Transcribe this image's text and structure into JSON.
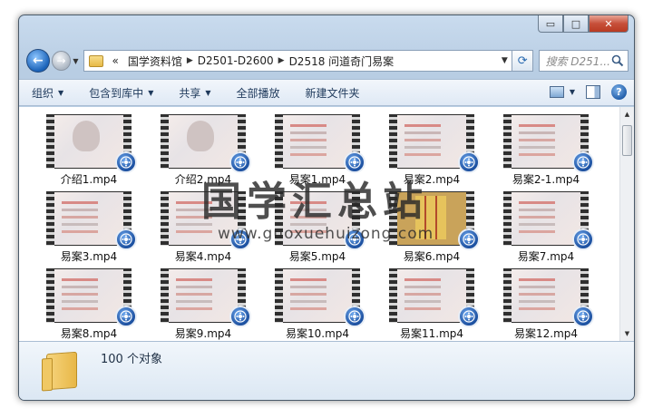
{
  "window": {
    "caption": {
      "minimize": "▭",
      "maximize": "□",
      "close": "✕"
    }
  },
  "nav": {
    "back_glyph": "←",
    "forward_glyph": "→",
    "overflow": "«",
    "breadcrumbs": [
      "国学资料馆",
      "D2501-D2600",
      "D2518 问道奇门易案"
    ],
    "search_placeholder": "搜索 D251..."
  },
  "toolbar": {
    "organize": "组织",
    "include_library": "包含到库中",
    "share": "共享",
    "play_all": "全部播放",
    "new_folder": "新建文件夹",
    "help": "?"
  },
  "files": [
    {
      "name": "介绍1.mp4",
      "thumb": "person"
    },
    {
      "name": "介绍2.mp4",
      "thumb": "person"
    },
    {
      "name": "易案1.mp4",
      "thumb": "doc"
    },
    {
      "name": "易案2.mp4",
      "thumb": "doc"
    },
    {
      "name": "易案2-1.mp4",
      "thumb": "doc"
    },
    {
      "name": "易案3.mp4",
      "thumb": "doc"
    },
    {
      "name": "易案4.mp4",
      "thumb": "doc"
    },
    {
      "name": "易案5.mp4",
      "thumb": "doc"
    },
    {
      "name": "易案6.mp4",
      "thumb": "grid"
    },
    {
      "name": "易案7.mp4",
      "thumb": "doc"
    },
    {
      "name": "易案8.mp4",
      "thumb": "doc"
    },
    {
      "name": "易案9.mp4",
      "thumb": "doc"
    },
    {
      "name": "易案10.mp4",
      "thumb": "doc"
    },
    {
      "name": "易案11.mp4",
      "thumb": "doc"
    },
    {
      "name": "易案12.mp4",
      "thumb": "doc"
    }
  ],
  "details": {
    "count": "100 个对象"
  },
  "watermark": {
    "title": "国学汇总站",
    "url": "www.guoxuehuizong.com"
  }
}
